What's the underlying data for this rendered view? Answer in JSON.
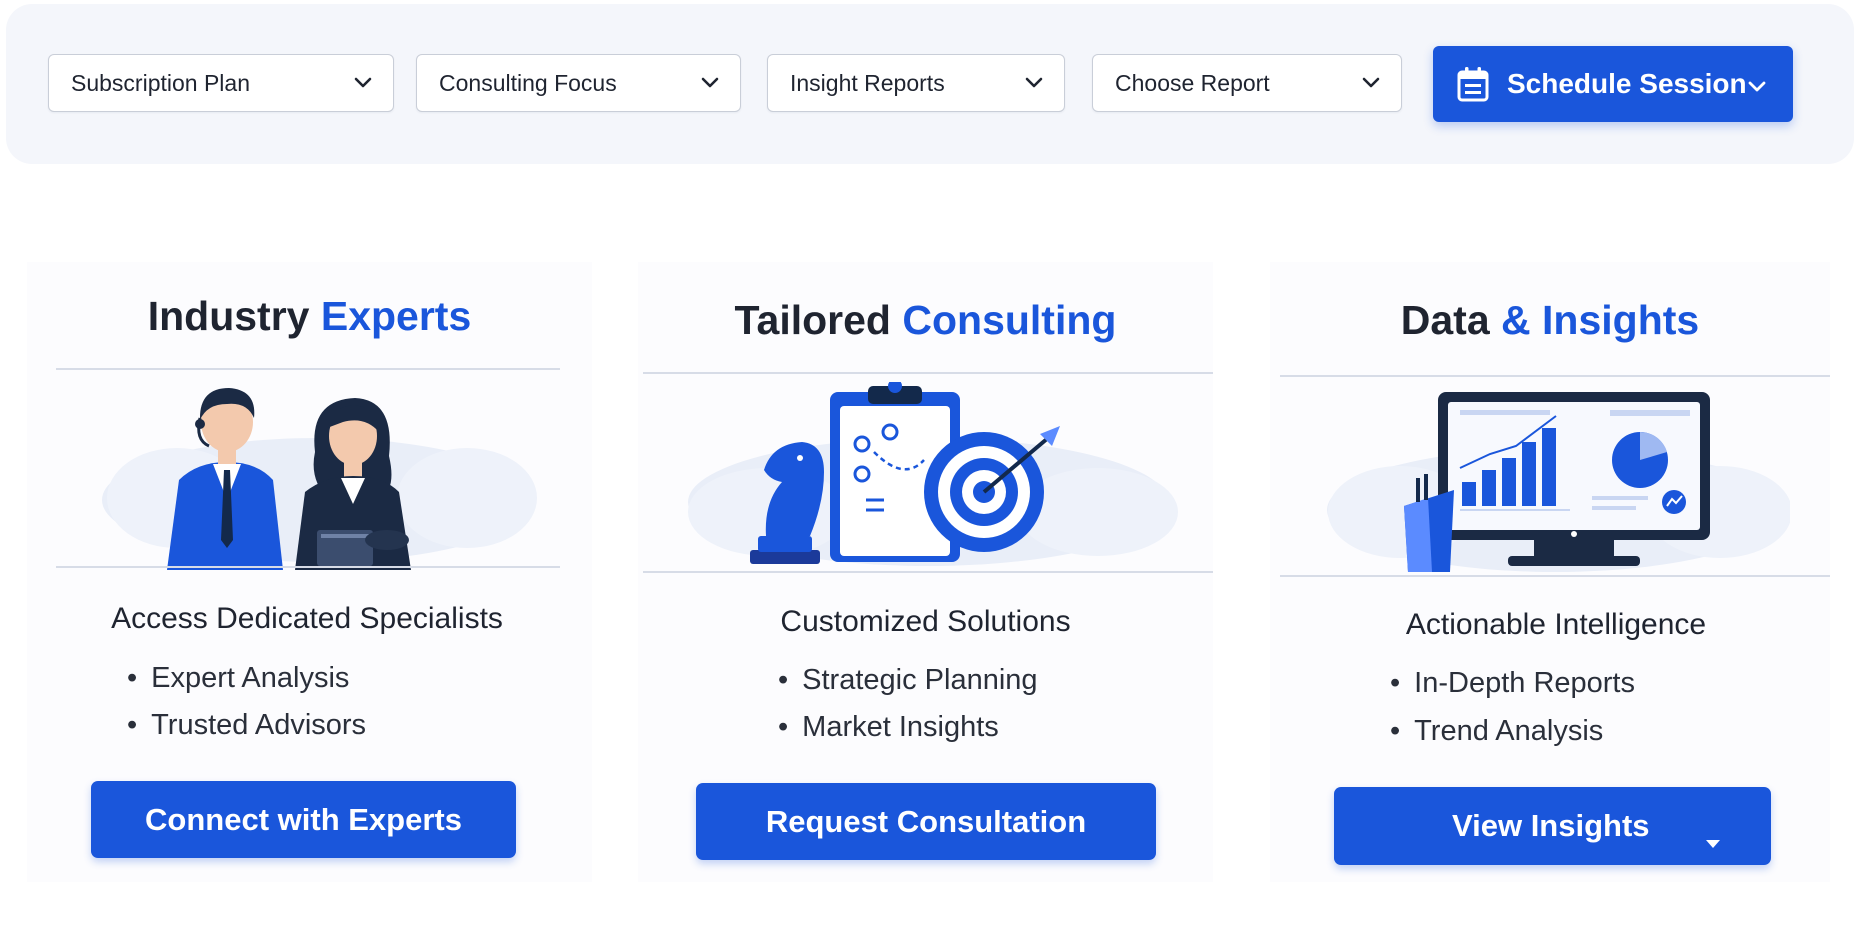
{
  "toolbar": {
    "filters": [
      {
        "label": "Subscription Plan"
      },
      {
        "label": "Consulting Focus"
      },
      {
        "label": "Insight Reports"
      },
      {
        "label": "Choose Report"
      }
    ],
    "schedule_button": {
      "label": "Schedule Session",
      "icon": "calendar-icon"
    }
  },
  "cards": [
    {
      "title_plain": "Industry ",
      "title_accent": "Experts",
      "subtitle": "Access Dedicated Specialists",
      "bullets": [
        "Expert Analysis",
        "Trusted Advisors"
      ],
      "button": "Connect with Experts",
      "illustration": "consultants-illustration"
    },
    {
      "title_plain": "Tailored ",
      "title_accent": "Consulting",
      "subtitle": "Customized Solutions",
      "bullets": [
        "Strategic Planning",
        "Market Insights"
      ],
      "button": "Request Consultation",
      "illustration": "strategy-illustration"
    },
    {
      "title_plain": "Data ",
      "title_accent": "& Insights",
      "subtitle": "Actionable Intelligence",
      "bullets": [
        "In-Depth Reports",
        "Trend Analysis"
      ],
      "button": "View Insights",
      "illustration": "dashboard-illustration"
    }
  ],
  "colors": {
    "accent": "#1a56db",
    "text": "#1f2430",
    "toolbar_bg": "#f4f6fb"
  }
}
